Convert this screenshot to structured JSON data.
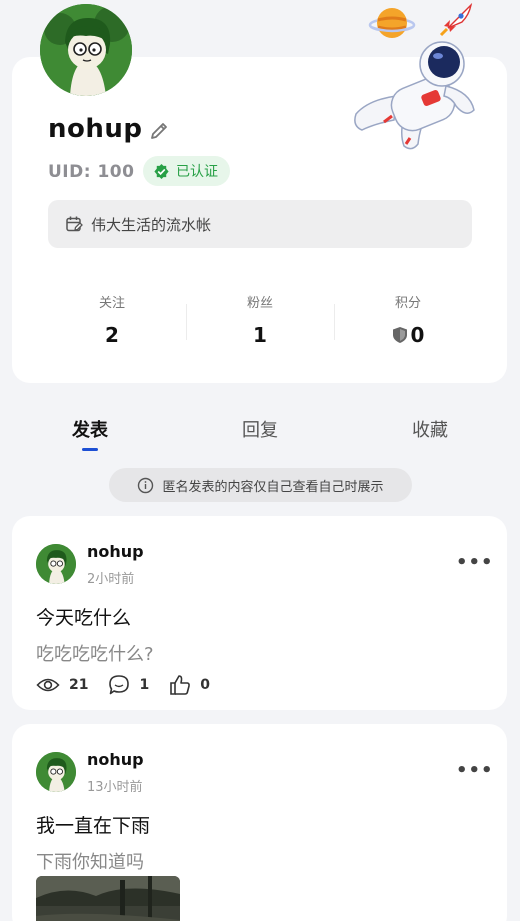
{
  "profile": {
    "username": "nohup",
    "uid": "UID: 100",
    "verified_label": "已认证",
    "bio": "伟大生活的流水帐",
    "stats": [
      {
        "label": "关注",
        "value": "2"
      },
      {
        "label": "粉丝",
        "value": "1"
      },
      {
        "label": "积分",
        "value": "0"
      }
    ]
  },
  "tabs": [
    {
      "label": "发表",
      "active": true
    },
    {
      "label": "回复",
      "active": false
    },
    {
      "label": "收藏",
      "active": false
    }
  ],
  "notice": "匿名发表的内容仅自己查看自己时展示",
  "posts": [
    {
      "user": "nohup",
      "time": "2小时前",
      "title": "今天吃什么",
      "body": "吃吃吃吃什么?",
      "views": "21",
      "comments": "1",
      "likes": "0"
    },
    {
      "user": "nohup",
      "time": "13小时前",
      "title": "我一直在下雨",
      "body": "下雨你知道吗"
    }
  ],
  "colors": {
    "accent": "#1c4fd4",
    "verified_green": "#27a046",
    "background": "#f3f4f7"
  },
  "icons": [
    "edit-icon",
    "verified-check-icon",
    "calendar-edit-icon",
    "shield-icon",
    "info-icon",
    "more-icon",
    "eye-icon",
    "comment-icon",
    "thumbs-up-icon",
    "planet-icon",
    "rocket-icon",
    "astronaut-illustration"
  ]
}
